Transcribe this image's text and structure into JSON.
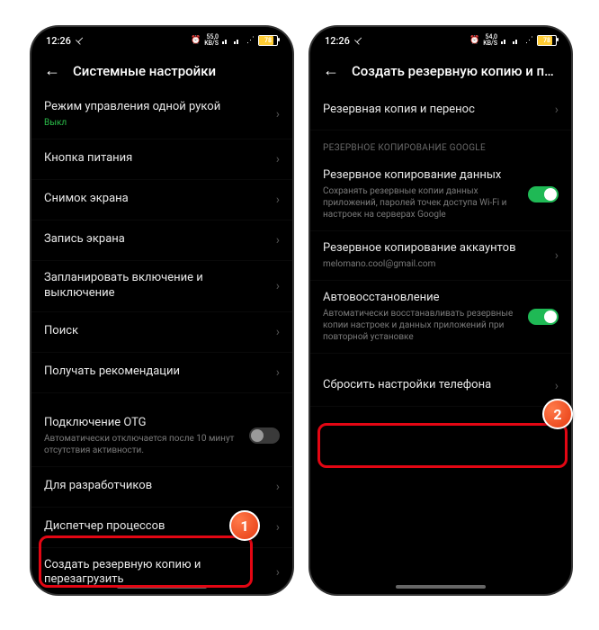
{
  "status": {
    "time": "12:26",
    "net": "54,0",
    "netUnit": "KB/S",
    "net2": "55,0",
    "battery": "78",
    "battery2": "78"
  },
  "left": {
    "title": "Системные настройки",
    "rows": {
      "oneHand": {
        "label": "Режим управления одной рукой",
        "sub": "Выкл"
      },
      "power": {
        "label": "Кнопка питания"
      },
      "screenshot": {
        "label": "Снимок экрана"
      },
      "screenrec": {
        "label": "Запись экрана"
      },
      "schedule": {
        "label": "Запланировать включение и выключение"
      },
      "search": {
        "label": "Поиск"
      },
      "recs": {
        "label": "Получать рекомендации"
      },
      "otg": {
        "label": "Подключение OTG",
        "sub": "Автоматически отключается после 10 минут отсутствия активности."
      },
      "dev": {
        "label": "Для разработчиков"
      },
      "procs": {
        "label": "Диспетчер процессов"
      },
      "backup": {
        "label": "Создать резервную копию и перезагрузить"
      }
    },
    "marker": "1"
  },
  "right": {
    "title": "Создать резервную копию и перезаг...",
    "rows": {
      "transfer": {
        "label": "Резервная копия и перенос"
      },
      "section": "РЕЗЕРВНОЕ КОПИРОВАНИЕ GOOGLE",
      "data": {
        "label": "Резервное копирование данных",
        "sub": "Сохранять резервные копии данных приложений, паролей точек доступа Wi-Fi и настроек на серверах Google"
      },
      "acct": {
        "label": "Резервное копирование аккаунтов",
        "sub": "melomano.cool@gmail.com"
      },
      "auto": {
        "label": "Автовосстановление",
        "sub": "Автоматически восстанавливать резервные копии настроек и данных приложений при повторной установке"
      },
      "reset": {
        "label": "Сбросить настройки телефона"
      }
    },
    "marker": "2"
  }
}
